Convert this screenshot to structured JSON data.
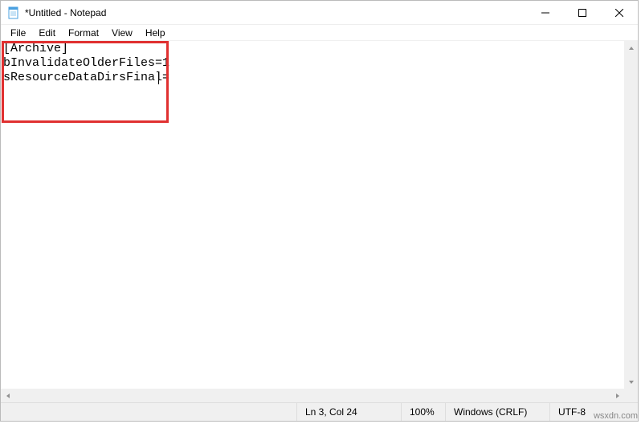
{
  "titlebar": {
    "icon_name": "notepad-icon",
    "title": "*Untitled - Notepad"
  },
  "window_controls": {
    "minimize": "minimize",
    "maximize": "maximize",
    "close": "close"
  },
  "menubar": {
    "items": [
      "File",
      "Edit",
      "Format",
      "View",
      "Help"
    ]
  },
  "editor": {
    "text": "[Archive]\nbInvalidateOlderFiles=1\nsResourceDataDirsFinal="
  },
  "statusbar": {
    "lncol": "Ln 3, Col 24",
    "zoom": "100%",
    "eol": "Windows (CRLF)",
    "encoding": "UTF-8"
  },
  "watermark": "wsxdn.com"
}
